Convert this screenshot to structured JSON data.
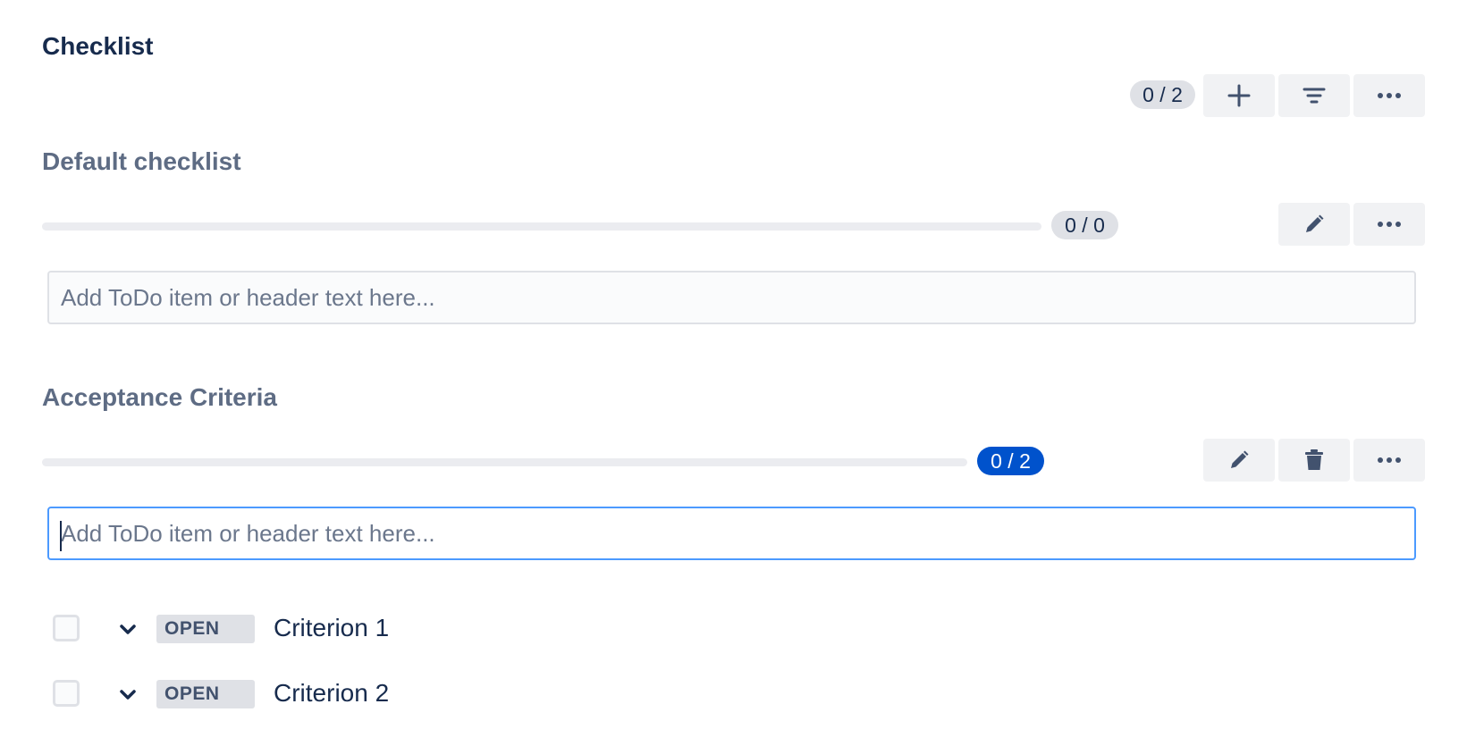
{
  "header": {
    "title": "Checklist",
    "progress": "0 / 2",
    "add_icon": "plus-icon",
    "filter_icon": "filter-icon",
    "more_icon": "more-icon"
  },
  "checklists": [
    {
      "title": "Default checklist",
      "progress": "0 / 0",
      "progress_fraction": 0,
      "input_placeholder": "Add ToDo item or header text here...",
      "actions": [
        "edit-icon",
        "more-icon"
      ],
      "items": []
    },
    {
      "title": "Acceptance Criteria",
      "progress": "0 / 2",
      "progress_fraction": 0,
      "input_placeholder": "Add ToDo item or header text here...",
      "input_focused": true,
      "actions": [
        "edit-icon",
        "trash-icon",
        "more-icon"
      ],
      "items": [
        {
          "checked": false,
          "status": "OPEN",
          "text": "Criterion 1"
        },
        {
          "checked": false,
          "status": "OPEN",
          "text": "Criterion 2"
        }
      ]
    }
  ],
  "colors": {
    "text_primary": "#172b4d",
    "text_subtle": "#5e6c84",
    "active_badge": "#0052cc",
    "focus_border": "#4c9aff",
    "neutral_badge": "#dfe1e6"
  }
}
